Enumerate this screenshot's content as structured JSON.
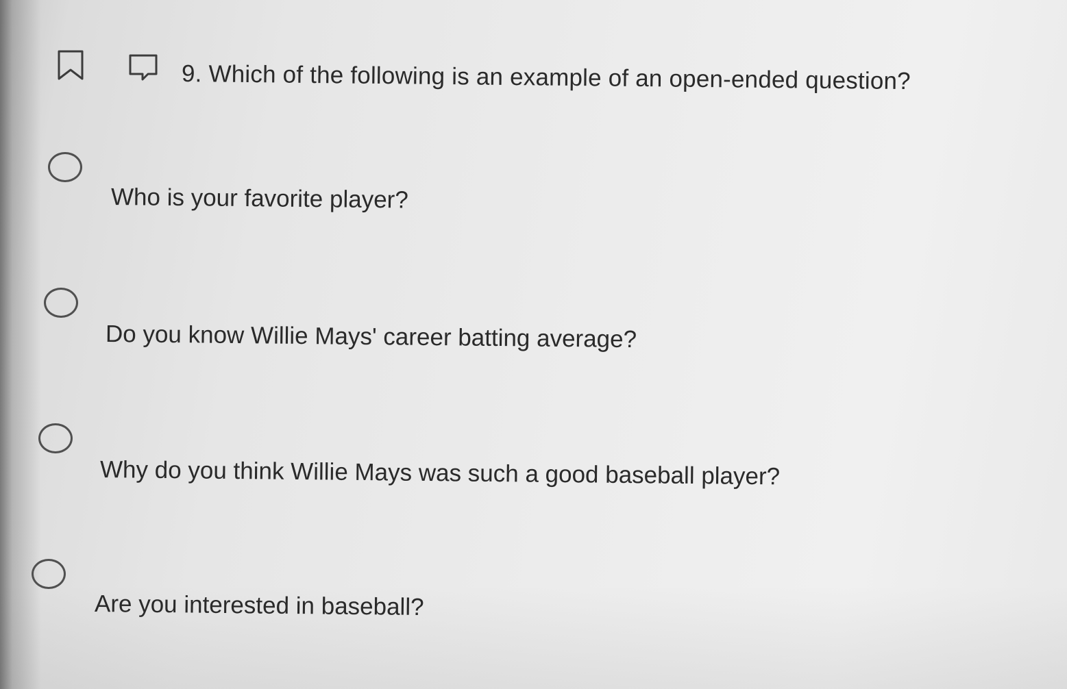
{
  "question": {
    "text": "9. Which of the following is an example of an open-ended question?"
  },
  "toolbar": {
    "bookmark_icon": "bookmark-icon",
    "flag_icon": "flag-comment-icon"
  },
  "options": [
    {
      "label": "Who is your favorite player?",
      "selected": false
    },
    {
      "label": "Do you know Willie Mays' career batting average?",
      "selected": false
    },
    {
      "label": "Why do you think Willie Mays was such a good baseball player?",
      "selected": false
    },
    {
      "label": "Are you interested in baseball?",
      "selected": false
    }
  ]
}
